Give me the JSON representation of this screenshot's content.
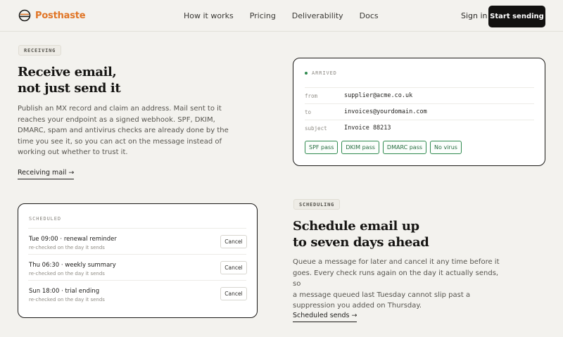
{
  "brand": {
    "name": "Posthaste",
    "accent": "#e07526",
    "icon": "logo-icon"
  },
  "nav": {
    "items": [
      "How it works",
      "Pricing",
      "Deliverability",
      "Docs"
    ],
    "signin": "Sign in",
    "cta": "Start sending"
  },
  "receiving": {
    "tag": "RECEIVING",
    "heading_line1": "Receive email,",
    "heading_line2": "not just send it",
    "paragraph_lines": [
      "Publish an MX record and claim an address. Mail sent to it",
      "reaches your endpoint as a signed webhook. SPF, DKIM,",
      "DMARC, spam and antivirus checks are already done by the",
      "time you see it, so you can act on the message instead of",
      "working out whether to trust it."
    ],
    "link": "Receiving mail →",
    "card": {
      "status": "ARRIVED",
      "status_color": "#2f8a4f",
      "fields": [
        {
          "key": "from",
          "value": "supplier@acme.co.uk"
        },
        {
          "key": "to",
          "value": "invoices@yourdomain.com"
        },
        {
          "key": "subject",
          "value": "Invoice 88213"
        }
      ],
      "checks": [
        "SPF pass",
        "DKIM pass",
        "DMARC pass",
        "No virus"
      ]
    }
  },
  "scheduling": {
    "tag": "SCHEDULING",
    "heading_line1": "Schedule email up",
    "heading_line2": "to seven days ahead",
    "paragraph_lines": [
      "Queue a message for later and cancel it any time before it",
      "goes. Every check runs again on the day it actually sends, so",
      "a message queued last Tuesday cannot slip past a",
      "suppression you added on Thursday."
    ],
    "link": "Scheduled sends →",
    "card": {
      "label": "SCHEDULED",
      "rows": [
        {
          "title": "Tue 09:00 · renewal reminder",
          "sub": "re-checked on the day it sends",
          "action": "Cancel"
        },
        {
          "title": "Thu 06:30 · weekly summary",
          "sub": "re-checked on the day it sends",
          "action": "Cancel"
        },
        {
          "title": "Sun 18:00 · trial ending",
          "sub": "re-checked on the day it sends",
          "action": "Cancel"
        }
      ]
    }
  }
}
